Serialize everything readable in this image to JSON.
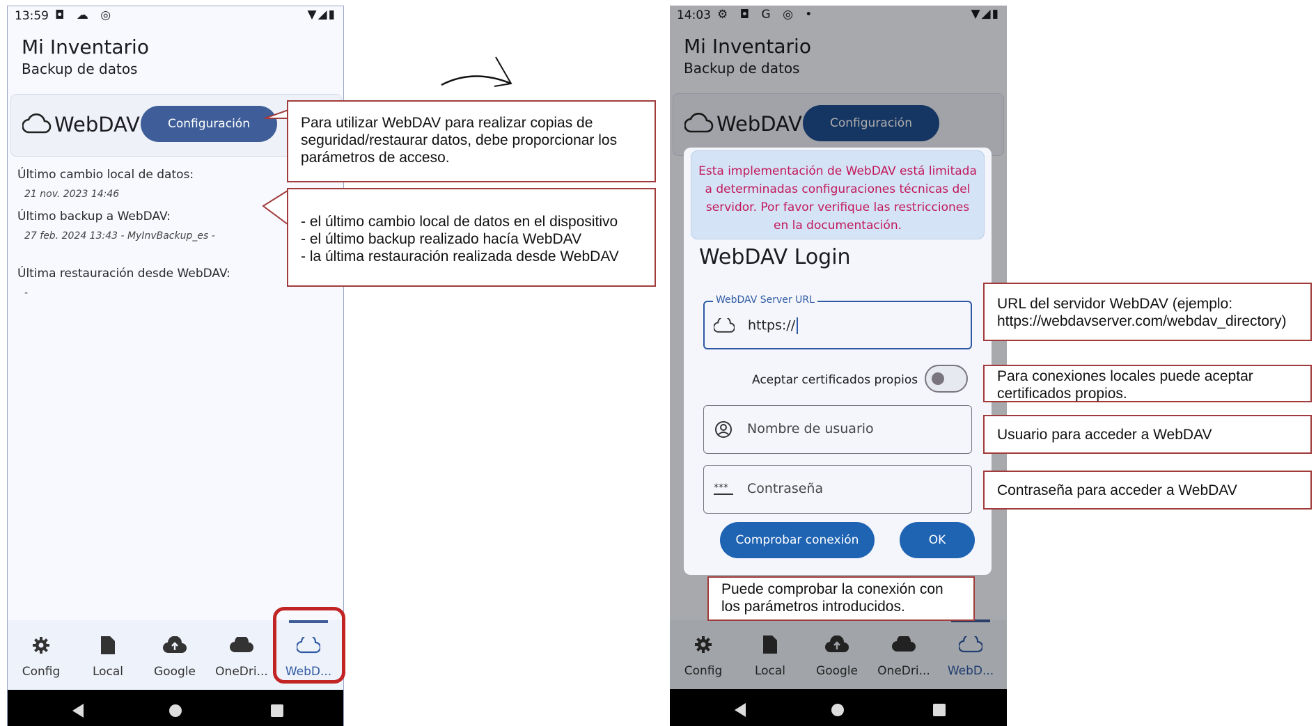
{
  "left": {
    "status": {
      "time": "13:59",
      "icons": "◘ ☁ ◎",
      "right": "▼◢▮"
    },
    "app_title": "Mi Inventario",
    "app_subtitle": "Backup de datos",
    "card_title": "WebDAV",
    "config_button": "Configuración",
    "info": [
      {
        "label": "Último cambio local de datos:",
        "value": "21 nov. 2023 14:46"
      },
      {
        "label": "Último backup a WebDAV:",
        "value": "27 feb. 2024 13:43 - MyInvBackup_es -"
      },
      {
        "label": "Última restauración desde WebDAV:",
        "value": "-"
      }
    ],
    "nav": [
      "Config",
      "Local",
      "Google",
      "OneDri...",
      "WebD..."
    ]
  },
  "right": {
    "status": {
      "time": "14:03",
      "icons": "⚙ ◘ G ◎ •",
      "right": "▼◢▮"
    },
    "app_title": "Mi Inventario",
    "app_subtitle": "Backup de datos",
    "card_title": "WebDAV",
    "config_button": "Configuración",
    "warning": "Esta implementación de WebDAV está limitada a determinadas configuraciones técnicas del servidor. Por favor verifique las restricciones en la documentación.",
    "dialog_title": "WebDAV Login",
    "url_label": "WebDAV Server URL",
    "url_value": "https://",
    "toggle_label": "Aceptar certificados propios",
    "username_placeholder": "Nombre de usuario",
    "password_placeholder": "Contraseña",
    "test_button": "Comprobar conexión",
    "ok_button": "OK",
    "nav": [
      "Config",
      "Local",
      "Google",
      "OneDri...",
      "WebD..."
    ]
  },
  "callouts": {
    "config": "Para utilizar WebDAV para realizar copias de seguridad/restaurar datos, debe proporcionar los parámetros de acceso.",
    "info_lines": [
      "- el último cambio local de datos en el dispositivo",
      "- el último backup realizado hacía WebDAV",
      "- la última restauración realizada desde WebDAV"
    ],
    "url": "URL del servidor WebDAV (ejemplo: https://webdavserver.com/webdav_directory)",
    "certs": "Para conexiones locales puede aceptar certificados propios.",
    "user": "Usuario para acceder a WebDAV",
    "password": "Contraseña para acceder a WebDAV",
    "test": "Puede comprobar la conexión con los parámetros introducidos."
  },
  "colors": {
    "accent": "#3f5e99",
    "button": "#1f63b3",
    "callout_border": "#a13b3b",
    "warning_text": "#c2185b",
    "highlight": "#c22323"
  }
}
